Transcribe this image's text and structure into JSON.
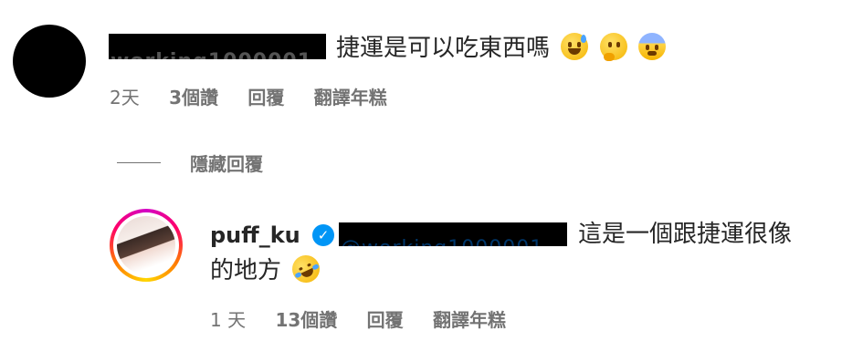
{
  "comment": {
    "redacted_peek": "working1000001",
    "text": "捷運是可以吃東西嗎",
    "emojis": [
      "sweat-smile-emoji",
      "thinking-face-emoji",
      "fearful-face-emoji"
    ],
    "meta": {
      "time": "2天",
      "likes": "3個讚",
      "reply": "回覆",
      "translate": "翻譯年糕"
    }
  },
  "hide_replies_label": "隱藏回覆",
  "reply": {
    "username": "puff_ku",
    "verified_mark": "✓",
    "mention_peek": "@working1000001",
    "text_line1": "這是一個跟捷運很像",
    "text_line2": "的地方",
    "emoji": "rolling-on-floor-laughing-emoji",
    "meta": {
      "time": "1 天",
      "likes": "13個讚",
      "reply": "回覆",
      "translate": "翻譯年糕"
    }
  },
  "colors": {
    "text": "#262626",
    "secondary": "#737373",
    "verified": "#0095f6",
    "mention": "#00376b"
  }
}
